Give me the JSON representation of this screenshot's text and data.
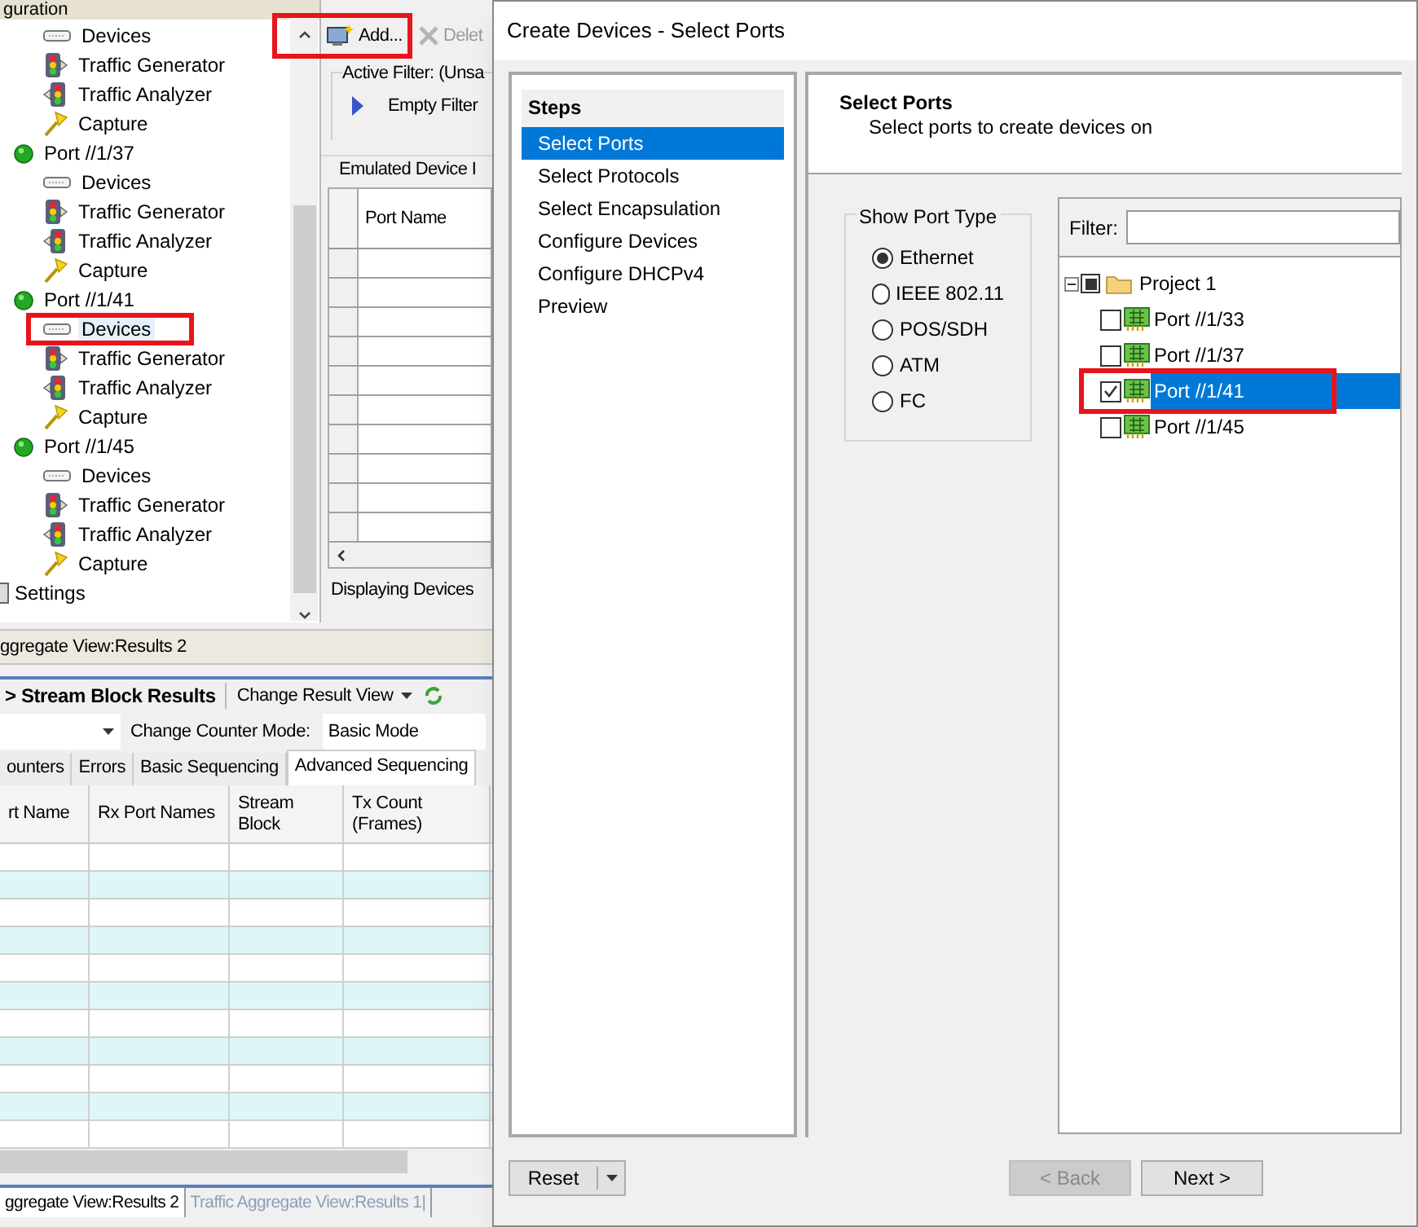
{
  "config_tree": {
    "header": "guration",
    "orphan_children": [
      {
        "kind": "devices",
        "label": "Devices",
        "selected": false,
        "highlighted": false
      },
      {
        "kind": "generator",
        "label": "Traffic Generator",
        "selected": false,
        "highlighted": false
      },
      {
        "kind": "analyzer",
        "label": "Traffic Analyzer",
        "selected": false,
        "highlighted": false
      },
      {
        "kind": "capture",
        "label": "Capture",
        "selected": false,
        "highlighted": false
      }
    ],
    "ports": [
      {
        "label": "Port //1/37",
        "children": [
          {
            "kind": "devices",
            "label": "Devices",
            "selected": false,
            "highlighted": false
          },
          {
            "kind": "generator",
            "label": "Traffic Generator",
            "selected": false,
            "highlighted": false
          },
          {
            "kind": "analyzer",
            "label": "Traffic Analyzer",
            "selected": false,
            "highlighted": false
          },
          {
            "kind": "capture",
            "label": "Capture",
            "selected": false,
            "highlighted": false
          }
        ]
      },
      {
        "label": "Port //1/41",
        "children": [
          {
            "kind": "devices",
            "label": "Devices",
            "selected": true,
            "highlighted": true
          },
          {
            "kind": "generator",
            "label": "Traffic Generator",
            "selected": false,
            "highlighted": false
          },
          {
            "kind": "analyzer",
            "label": "Traffic Analyzer",
            "selected": false,
            "highlighted": false
          },
          {
            "kind": "capture",
            "label": "Capture",
            "selected": false,
            "highlighted": false
          }
        ]
      },
      {
        "label": "Port //1/45",
        "children": [
          {
            "kind": "devices",
            "label": "Devices",
            "selected": false,
            "highlighted": false
          },
          {
            "kind": "generator",
            "label": "Traffic Generator",
            "selected": false,
            "highlighted": false
          },
          {
            "kind": "analyzer",
            "label": "Traffic Analyzer",
            "selected": false,
            "highlighted": false
          },
          {
            "kind": "capture",
            "label": "Capture",
            "selected": false,
            "highlighted": false
          }
        ]
      }
    ],
    "settings": "Settings"
  },
  "devices_panel": {
    "add_button": {
      "label": "Add...",
      "highlighted": true
    },
    "delete_button": {
      "label": "Delet",
      "disabled": true
    },
    "active_filter": "Active Filter:  (Unsa",
    "empty_filter": "Empty Filter",
    "grid_title": "Emulated Device I",
    "columns": [
      "Port Name"
    ],
    "status": "Displaying Devices"
  },
  "results": {
    "title": "ggregate View:Results 2",
    "breadcrumb": "> Stream Block Results",
    "change_view": "Change Result View",
    "counter_mode_label": "Change Counter Mode:",
    "counter_mode": "Basic Mode",
    "tabs": [
      {
        "label": "ounters",
        "selected": false
      },
      {
        "label": "Errors",
        "selected": false
      },
      {
        "label": "Basic Sequencing",
        "selected": false
      },
      {
        "label": "Advanced Sequencing",
        "selected": true
      }
    ],
    "columns": [
      "rt Name",
      "Rx Port Names",
      "Stream Block",
      "Tx Count (Frames)"
    ],
    "bottom_tabs": [
      {
        "label": "ggregate View:Results 2",
        "selected": true
      },
      {
        "label": "Traffic Aggregate View:Results 1|",
        "selected": false
      }
    ]
  },
  "dialog": {
    "title": "Create Devices - Select Ports",
    "steps_title": "Steps",
    "steps": [
      {
        "label": "Select Ports",
        "selected": true
      },
      {
        "label": "Select Protocols",
        "selected": false
      },
      {
        "label": "Select Encapsulation",
        "selected": false
      },
      {
        "label": "Configure Devices",
        "selected": false
      },
      {
        "label": "Configure DHCPv4",
        "selected": false
      },
      {
        "label": "Preview",
        "selected": false
      }
    ],
    "heading": "Select Ports",
    "subheading": "Select ports to create devices on",
    "port_type": {
      "title": "Show Port Type",
      "options": [
        {
          "label": "Ethernet",
          "selected": true
        },
        {
          "label": "IEEE 802.11",
          "selected": false
        },
        {
          "label": "POS/SDH",
          "selected": false
        },
        {
          "label": "ATM",
          "selected": false
        },
        {
          "label": "FC",
          "selected": false
        }
      ]
    },
    "filter_label": "Filter:",
    "project": {
      "label": "Project 1",
      "partially_checked": true,
      "expanded": true,
      "children": [
        {
          "label": "Port //1/33",
          "checked": false,
          "selected": false,
          "highlighted": false
        },
        {
          "label": "Port //1/37",
          "checked": false,
          "selected": false,
          "highlighted": false
        },
        {
          "label": "Port //1/41",
          "checked": true,
          "selected": true,
          "highlighted": true
        },
        {
          "label": "Port //1/45",
          "checked": false,
          "selected": false,
          "highlighted": false
        }
      ]
    },
    "buttons": [
      {
        "kind": "split",
        "label": "Reset",
        "disabled": false
      },
      {
        "kind": "plain",
        "label": "< Back",
        "disabled": true
      },
      {
        "kind": "plain",
        "label": "Next >",
        "disabled": false
      }
    ]
  }
}
